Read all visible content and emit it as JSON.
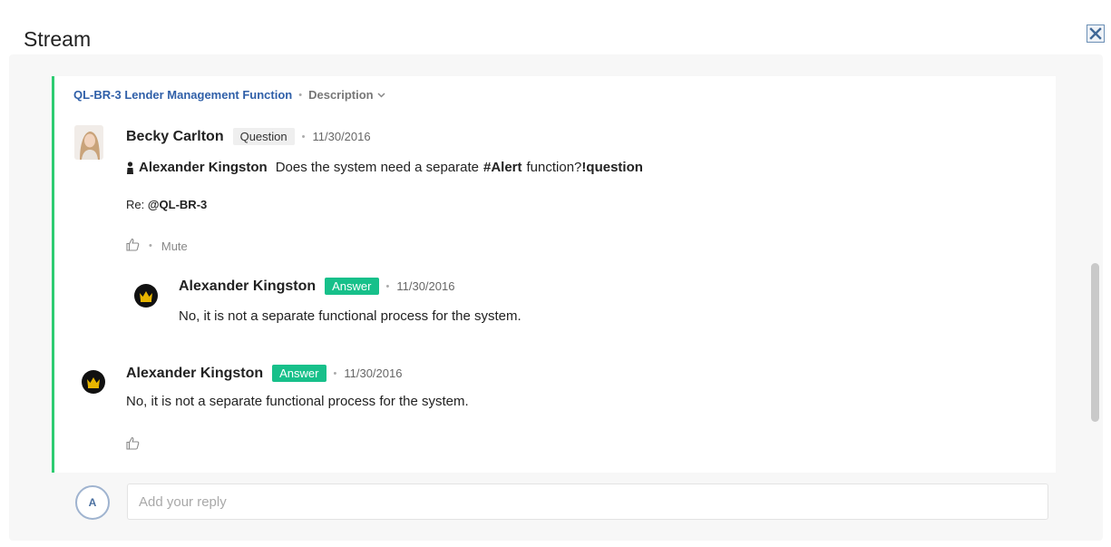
{
  "panel": {
    "title": "Stream"
  },
  "breadcrumb": {
    "link": "QL-BR-3 Lender Management Function",
    "separator": "•",
    "description": "Description"
  },
  "question_post": {
    "author": "Becky Carlton",
    "tag": "Question",
    "separator": "•",
    "date": "11/30/2016",
    "mention": "Alexander Kingston",
    "text_before": "Does the system need a separate",
    "hashtag": "#Alert",
    "text_after": "function?",
    "marker": "!question",
    "re_label": "Re:",
    "re_ref": "@QL-BR-3",
    "mute_label": "Mute"
  },
  "nested_answer": {
    "author": "Alexander Kingston",
    "tag": "Answer",
    "separator": "•",
    "date": "11/30/2016",
    "text": "No, it is not a separate functional process for the system."
  },
  "answer_post": {
    "author": "Alexander Kingston",
    "tag": "Answer",
    "separator": "•",
    "date": "11/30/2016",
    "text": "No, it is not a separate functional process for the system."
  },
  "reply": {
    "avatar_initial": "A",
    "placeholder": "Add your reply"
  },
  "colors": {
    "accent_green": "#2ecc71",
    "answer_tag": "#17c08a",
    "link_blue": "#2f5fa8"
  }
}
